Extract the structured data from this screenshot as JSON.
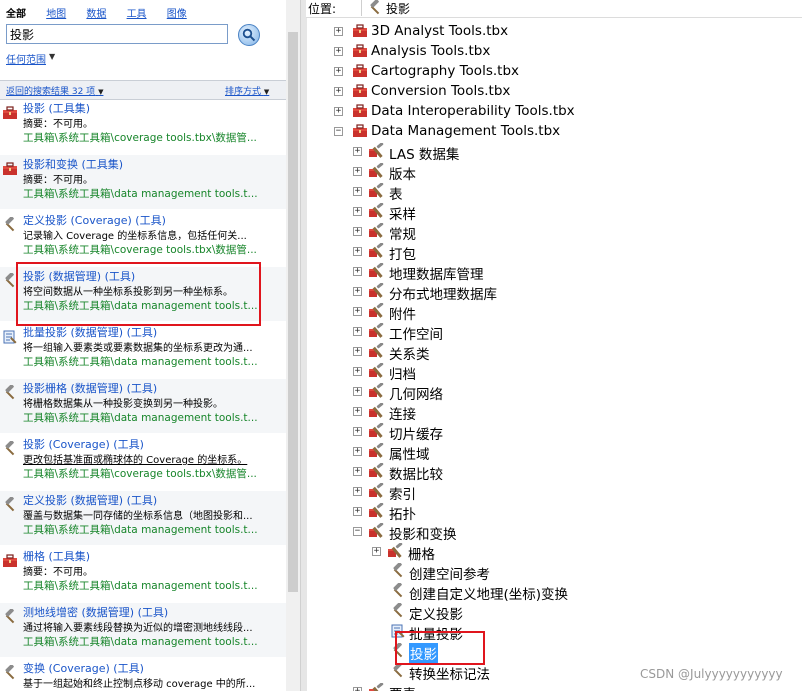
{
  "left_panel": {
    "tabs": [
      "全部",
      "地图",
      "数据",
      "工具",
      "图像"
    ],
    "search": {
      "value": "投影"
    },
    "scope_link": "任何范围",
    "results_label": "返回的搜索结果 32 项",
    "sort_label": "排序方式",
    "results": [
      {
        "title": "投影 (工具集)",
        "summary": "摘要：不可用。",
        "path": "工具箱\\系统工具箱\\coverage tools.tbx\\数据管...",
        "icon": "toolbox-icon"
      },
      {
        "title": "投影和变换 (工具集)",
        "summary": "摘要：不可用。",
        "path": "工具箱\\系统工具箱\\data management tools.t...",
        "icon": "toolbox-icon"
      },
      {
        "title": "定义投影 (Coverage) (工具)",
        "summary": "记录输入 Coverage 的坐标系信息，包括任何关...",
        "path": "工具箱\\系统工具箱\\coverage tools.tbx\\数据管...",
        "icon": "hammer-icon"
      },
      {
        "title": "投影 (数据管理) (工具)",
        "summary": "将空间数据从一种坐标系投影到另一种坐标系。",
        "path": "工具箱\\系统工具箱\\data management tools.t...",
        "icon": "hammer-icon"
      },
      {
        "title": "批量投影 (数据管理) (工具)",
        "summary": "将一组输入要素类或要素数据集的坐标系更改为通...",
        "path": "工具箱\\系统工具箱\\data management tools.t...",
        "icon": "script-icon"
      },
      {
        "title": "投影栅格 (数据管理) (工具)",
        "summary": "将栅格数据集从一种投影变换到另一种投影。",
        "path": "工具箱\\系统工具箱\\data management tools.t...",
        "icon": "hammer-icon"
      },
      {
        "title": "投影 (Coverage) (工具)",
        "summary": "更改包括基准面或椭球体的 Coverage 的坐标系。",
        "path": "工具箱\\系统工具箱\\coverage tools.tbx\\数据管...",
        "icon": "hammer-icon"
      },
      {
        "title": "定义投影 (数据管理) (工具)",
        "summary": "覆盖与数据集一同存储的坐标系信息（地图投影和...",
        "path": "工具箱\\系统工具箱\\data management tools.t...",
        "icon": "hammer-icon"
      },
      {
        "title": "栅格 (工具集)",
        "summary": "摘要：不可用。",
        "path": "工具箱\\系统工具箱\\data management tools.t...",
        "icon": "toolbox-icon"
      },
      {
        "title": "测地线增密 (数据管理) (工具)",
        "summary": "通过将输入要素线段替换为近似的增密测地线线段...",
        "path": "工具箱\\系统工具箱\\data management tools.t...",
        "icon": "hammer-icon"
      },
      {
        "title": "变换 (Coverage) (工具)",
        "summary": "基于一组起始和终止控制点移动 coverage 中的所...",
        "path": "",
        "icon": "hammer-icon"
      }
    ]
  },
  "right_panel": {
    "location_label": "位置:",
    "location_value": "投影",
    "tree": [
      {
        "label": "3D Analyst Tools.tbx",
        "icon": "toolbox-icon",
        "expander": "+",
        "level": 0
      },
      {
        "label": "Analysis Tools.tbx",
        "icon": "toolbox-icon",
        "expander": "+",
        "level": 0
      },
      {
        "label": "Cartography Tools.tbx",
        "icon": "toolbox-icon",
        "expander": "+",
        "level": 0
      },
      {
        "label": "Conversion Tools.tbx",
        "icon": "toolbox-icon",
        "expander": "+",
        "level": 0
      },
      {
        "label": "Data Interoperability Tools.tbx",
        "icon": "toolbox-icon",
        "expander": "+",
        "level": 0
      },
      {
        "label": "Data Management Tools.tbx",
        "icon": "toolbox-icon",
        "expander": "-",
        "level": 0
      },
      {
        "label": "LAS 数据集",
        "icon": "toolset-icon",
        "expander": "+",
        "level": 1
      },
      {
        "label": "版本",
        "icon": "toolset-icon",
        "expander": "+",
        "level": 1
      },
      {
        "label": "表",
        "icon": "toolset-icon",
        "expander": "+",
        "level": 1
      },
      {
        "label": "采样",
        "icon": "toolset-icon",
        "expander": "+",
        "level": 1
      },
      {
        "label": "常规",
        "icon": "toolset-icon",
        "expander": "+",
        "level": 1
      },
      {
        "label": "打包",
        "icon": "toolset-icon",
        "expander": "+",
        "level": 1
      },
      {
        "label": "地理数据库管理",
        "icon": "toolset-icon",
        "expander": "+",
        "level": 1
      },
      {
        "label": "分布式地理数据库",
        "icon": "toolset-icon",
        "expander": "+",
        "level": 1
      },
      {
        "label": "附件",
        "icon": "toolset-icon",
        "expander": "+",
        "level": 1
      },
      {
        "label": "工作空间",
        "icon": "toolset-icon",
        "expander": "+",
        "level": 1
      },
      {
        "label": "关系类",
        "icon": "toolset-icon",
        "expander": "+",
        "level": 1
      },
      {
        "label": "归档",
        "icon": "toolset-icon",
        "expander": "+",
        "level": 1
      },
      {
        "label": "几何网络",
        "icon": "toolset-icon",
        "expander": "+",
        "level": 1
      },
      {
        "label": "连接",
        "icon": "toolset-icon",
        "expander": "+",
        "level": 1
      },
      {
        "label": "切片缓存",
        "icon": "toolset-icon",
        "expander": "+",
        "level": 1
      },
      {
        "label": "属性域",
        "icon": "toolset-icon",
        "expander": "+",
        "level": 1
      },
      {
        "label": "数据比较",
        "icon": "toolset-icon",
        "expander": "+",
        "level": 1
      },
      {
        "label": "索引",
        "icon": "toolset-icon",
        "expander": "+",
        "level": 1
      },
      {
        "label": "拓扑",
        "icon": "toolset-icon",
        "expander": "+",
        "level": 1
      },
      {
        "label": "投影和变换",
        "icon": "toolset-icon",
        "expander": "-",
        "level": 1
      },
      {
        "label": "栅格",
        "icon": "toolset-icon",
        "expander": "+",
        "level": 2
      },
      {
        "label": "创建空间参考",
        "icon": "hammer-icon",
        "expander": "",
        "level": 2
      },
      {
        "label": "创建自定义地理(坐标)变换",
        "icon": "hammer-icon",
        "expander": "",
        "level": 2
      },
      {
        "label": "定义投影",
        "icon": "hammer-icon",
        "expander": "",
        "level": 2
      },
      {
        "label": "批量投影",
        "icon": "script-icon",
        "expander": "",
        "level": 2
      },
      {
        "label": "投影",
        "icon": "hammer-icon",
        "expander": "",
        "level": 2,
        "selected": true
      },
      {
        "label": "转换坐标记法",
        "icon": "hammer-icon",
        "expander": "",
        "level": 2
      },
      {
        "label": "要素",
        "icon": "toolset-icon",
        "expander": "+",
        "level": 1
      }
    ]
  },
  "watermark": "CSDN @Julyyyyyyyyyyy",
  "colors": {
    "link": "#1a55c9",
    "path_green": "#17852a",
    "highlight_red": "#e0151d",
    "selection": "#3399ff"
  }
}
